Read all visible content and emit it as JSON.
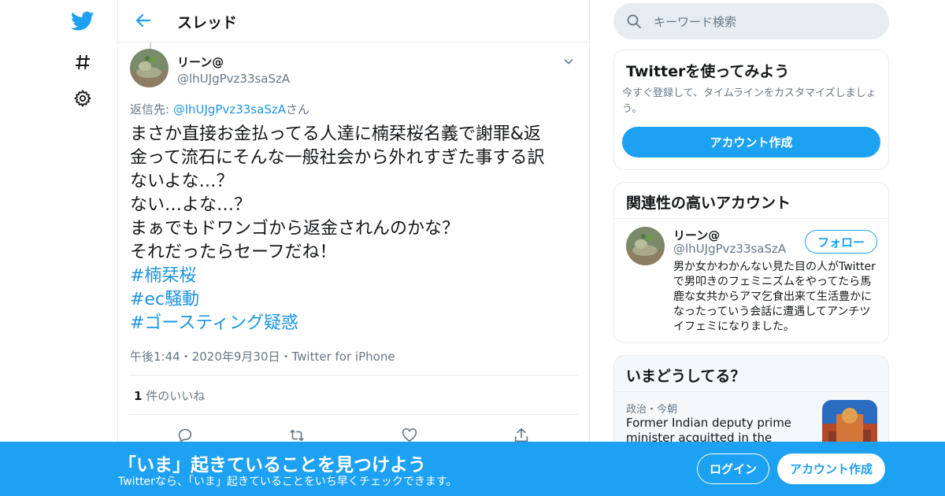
{
  "colors": {
    "accent": "#1da1f2",
    "link": "#1b95e0",
    "muted": "#657786",
    "border": "#e6ecf0"
  },
  "nav": {
    "icons": [
      "twitter-logo-icon",
      "hashtag-icon",
      "gear-icon"
    ]
  },
  "header": {
    "title": "スレッド"
  },
  "tweet": {
    "name": "リーン@",
    "handle": "@lhUJgPvz33saSzA",
    "reply_prefix": "返信先: ",
    "reply_handle": "@lhUJgPvz33saSzA",
    "reply_suffix": "さん",
    "lines": [
      "まさか直接お金払ってる人達に楠栞桜名義で謝罪&返",
      "金って流石にそんな一般社会から外れすぎた事する訳",
      "ないよな…？",
      "ない…よな…？",
      "まぁでもドワンゴから返金されんのかな？",
      "それだったらセーフだね！"
    ],
    "hashtags": [
      "#楠栞桜",
      "#ec騒動",
      "#ゴースティング疑惑"
    ],
    "meta": "午後1:44・2020年9月30日・Twitter for iPhone",
    "likes_count": "1",
    "likes_label": " 件のいいね"
  },
  "search": {
    "placeholder": "キーワード検索"
  },
  "try_card": {
    "title": "Twitterを使ってみよう",
    "desc": "今すぐ登録して、タイムラインをカスタマイズしましょう。",
    "button": "アカウント作成"
  },
  "related": {
    "title": "関連性の高いアカウント",
    "name": "リーン@",
    "handle": "@lhUJgPvz33saSzA",
    "follow": "フォロー",
    "bio": "男か女かわかんない見た目の人がTwitterで男叩きのフェミニズムをやってたら馬鹿な女共からアマ乞食出来て生活豊かになったっていう会話に遭遇してアンチツイフェミになりました。"
  },
  "trends": {
    "title": "いまどうしてる？",
    "category": "政治・今朝",
    "text": "Former Indian deputy prime minister acquitted in the demolition"
  },
  "banner": {
    "title": "「いま」起きていることを見つけよう",
    "subtitle": "Twitterなら、「いま」起きていることをいち早くチェックできます。",
    "login": "ログイン",
    "signup": "アカウント作成"
  }
}
